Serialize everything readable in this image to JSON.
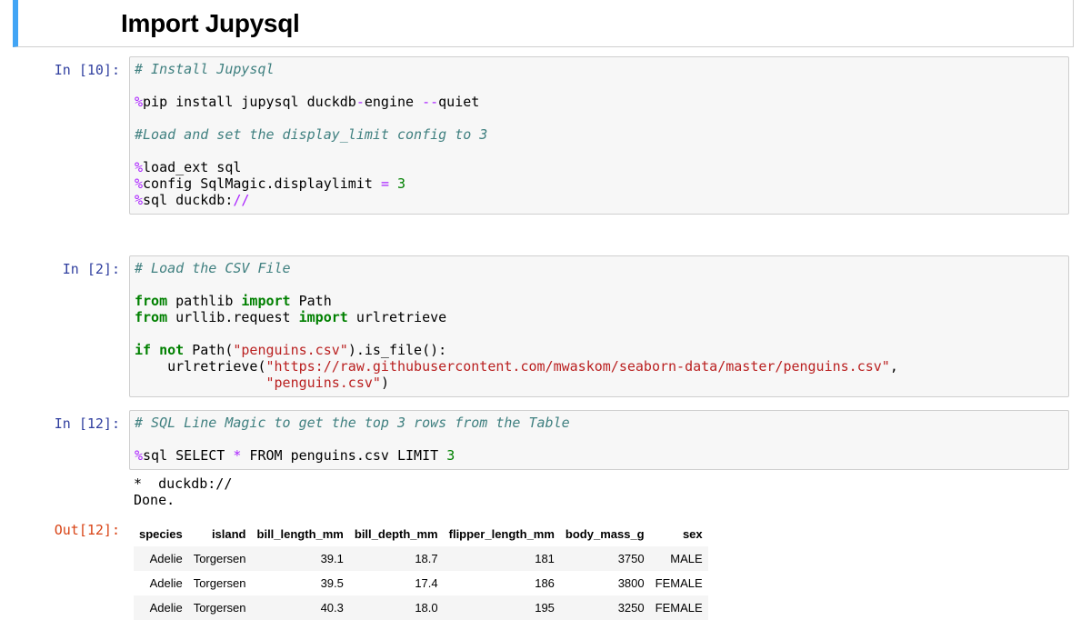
{
  "markdown": {
    "title": "Import Jupysql"
  },
  "cells": {
    "c1": {
      "prompt": "In [10]:",
      "lines": {
        "l1": "# Install Jupysql",
        "l2_mg": "%",
        "l2_a": "pip install jupysql duckdb",
        "l2_op": "-",
        "l2_b": "engine ",
        "l2_op2": "--",
        "l2_c": "quiet",
        "l3": "#Load and set the display_limit config to 3",
        "l4_mg": "%",
        "l4_a": "load_ext sql",
        "l5_mg": "%",
        "l5_a": "config SqlMagic.displaylimit ",
        "l5_op": "=",
        "l5_sp": " ",
        "l5_num": "3",
        "l6_mg": "%",
        "l6_a": "sql duckdb:",
        "l6_op": "//"
      }
    },
    "c2": {
      "prompt": "In [2]:",
      "lines": {
        "l1": "# Load the CSV File",
        "l2_kw1": "from",
        "l2_a": " pathlib ",
        "l2_kw2": "import",
        "l2_b": " Path",
        "l3_kw1": "from",
        "l3_a": " urllib.request ",
        "l3_kw2": "import",
        "l3_b": " urlretrieve",
        "l4_kw1": "if",
        "l4_sp": " ",
        "l4_kw2": "not",
        "l4_a": " Path(",
        "l4_str": "\"penguins.csv\"",
        "l4_b": ").is_file():",
        "l5_a": "    urlretrieve(",
        "l5_str": "\"https://raw.githubusercontent.com/mwaskom/seaborn-data/master/penguins.csv\"",
        "l5_b": ",",
        "l6_a": "                ",
        "l6_str": "\"penguins.csv\"",
        "l6_b": ")"
      }
    },
    "c3": {
      "prompt": "In [12]:",
      "lines": {
        "l1": "# SQL Line Magic to get the top 3 rows from the Table",
        "l2_mg": "%",
        "l2_a": "sql SELECT ",
        "l2_op": "*",
        "l2_b": " FROM penguins.csv LIMIT ",
        "l2_num": "3"
      },
      "output_lines": {
        "o1": "*  duckdb://",
        "o2": "Done."
      },
      "out_prompt": "Out[12]:"
    }
  },
  "table": {
    "headers": [
      "species",
      "island",
      "bill_length_mm",
      "bill_depth_mm",
      "flipper_length_mm",
      "body_mass_g",
      "sex"
    ],
    "rows": [
      [
        "Adelie",
        "Torgersen",
        "39.1",
        "18.7",
        "181",
        "3750",
        "MALE"
      ],
      [
        "Adelie",
        "Torgersen",
        "39.5",
        "17.4",
        "186",
        "3800",
        "FEMALE"
      ],
      [
        "Adelie",
        "Torgersen",
        "40.3",
        "18.0",
        "195",
        "3250",
        "FEMALE"
      ]
    ]
  },
  "colors": {
    "in_prompt": "#303f9f",
    "out_prompt": "#d84315",
    "selected_cell_bar": "#42a5f5",
    "comment": "#408080",
    "magic": "#aa22ff",
    "keyword": "#008000",
    "string": "#ba2121"
  }
}
